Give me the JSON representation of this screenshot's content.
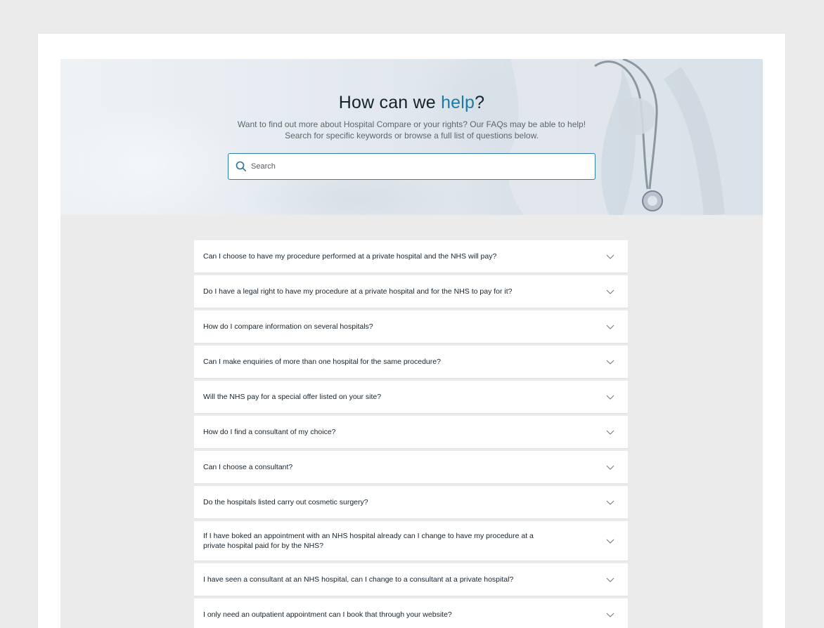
{
  "hero": {
    "title_prefix": "How can we ",
    "title_accent": "help",
    "title_suffix": "?",
    "subtitle_line1": "Want to find out more about Hospital Compare or your rights? Our FAQs may be able to help!",
    "subtitle_line2": "Search for specific keywords or browse a full list of questions below."
  },
  "search": {
    "placeholder": "Search",
    "value": "",
    "icon": "search-icon"
  },
  "colors": {
    "accent": "#1a7ba3",
    "search_border": "#2f7fa6",
    "page_bg": "#ebebeb"
  },
  "faqs": [
    {
      "question": "Can I choose to have my procedure performed at a private hospital and the NHS will pay?"
    },
    {
      "question": "Do I have a legal right to have my procedure at a private hospital and for the NHS to pay for it?"
    },
    {
      "question": "How do I compare information on several hospitals?"
    },
    {
      "question": "Can I make enquiries of more than one hospital for the same procedure?"
    },
    {
      "question": "Will the NHS pay for a special offer listed on your site?"
    },
    {
      "question": "How do I find a consultant of my choice?"
    },
    {
      "question": "Can I choose a consultant?"
    },
    {
      "question": "Do the hospitals listed carry out cosmetic surgery?"
    },
    {
      "question": "If I have boked an appointment with an NHS hospital already can I change to have my procedure at a private hospital paid for by the NHS?"
    },
    {
      "question": "I have seen a consultant at an NHS hospital, can I change to a consultant at a private hospital?"
    },
    {
      "question": "I only need an outpatient appointment can I book that through your website?"
    }
  ],
  "faq_icon": "chevron-down-icon"
}
